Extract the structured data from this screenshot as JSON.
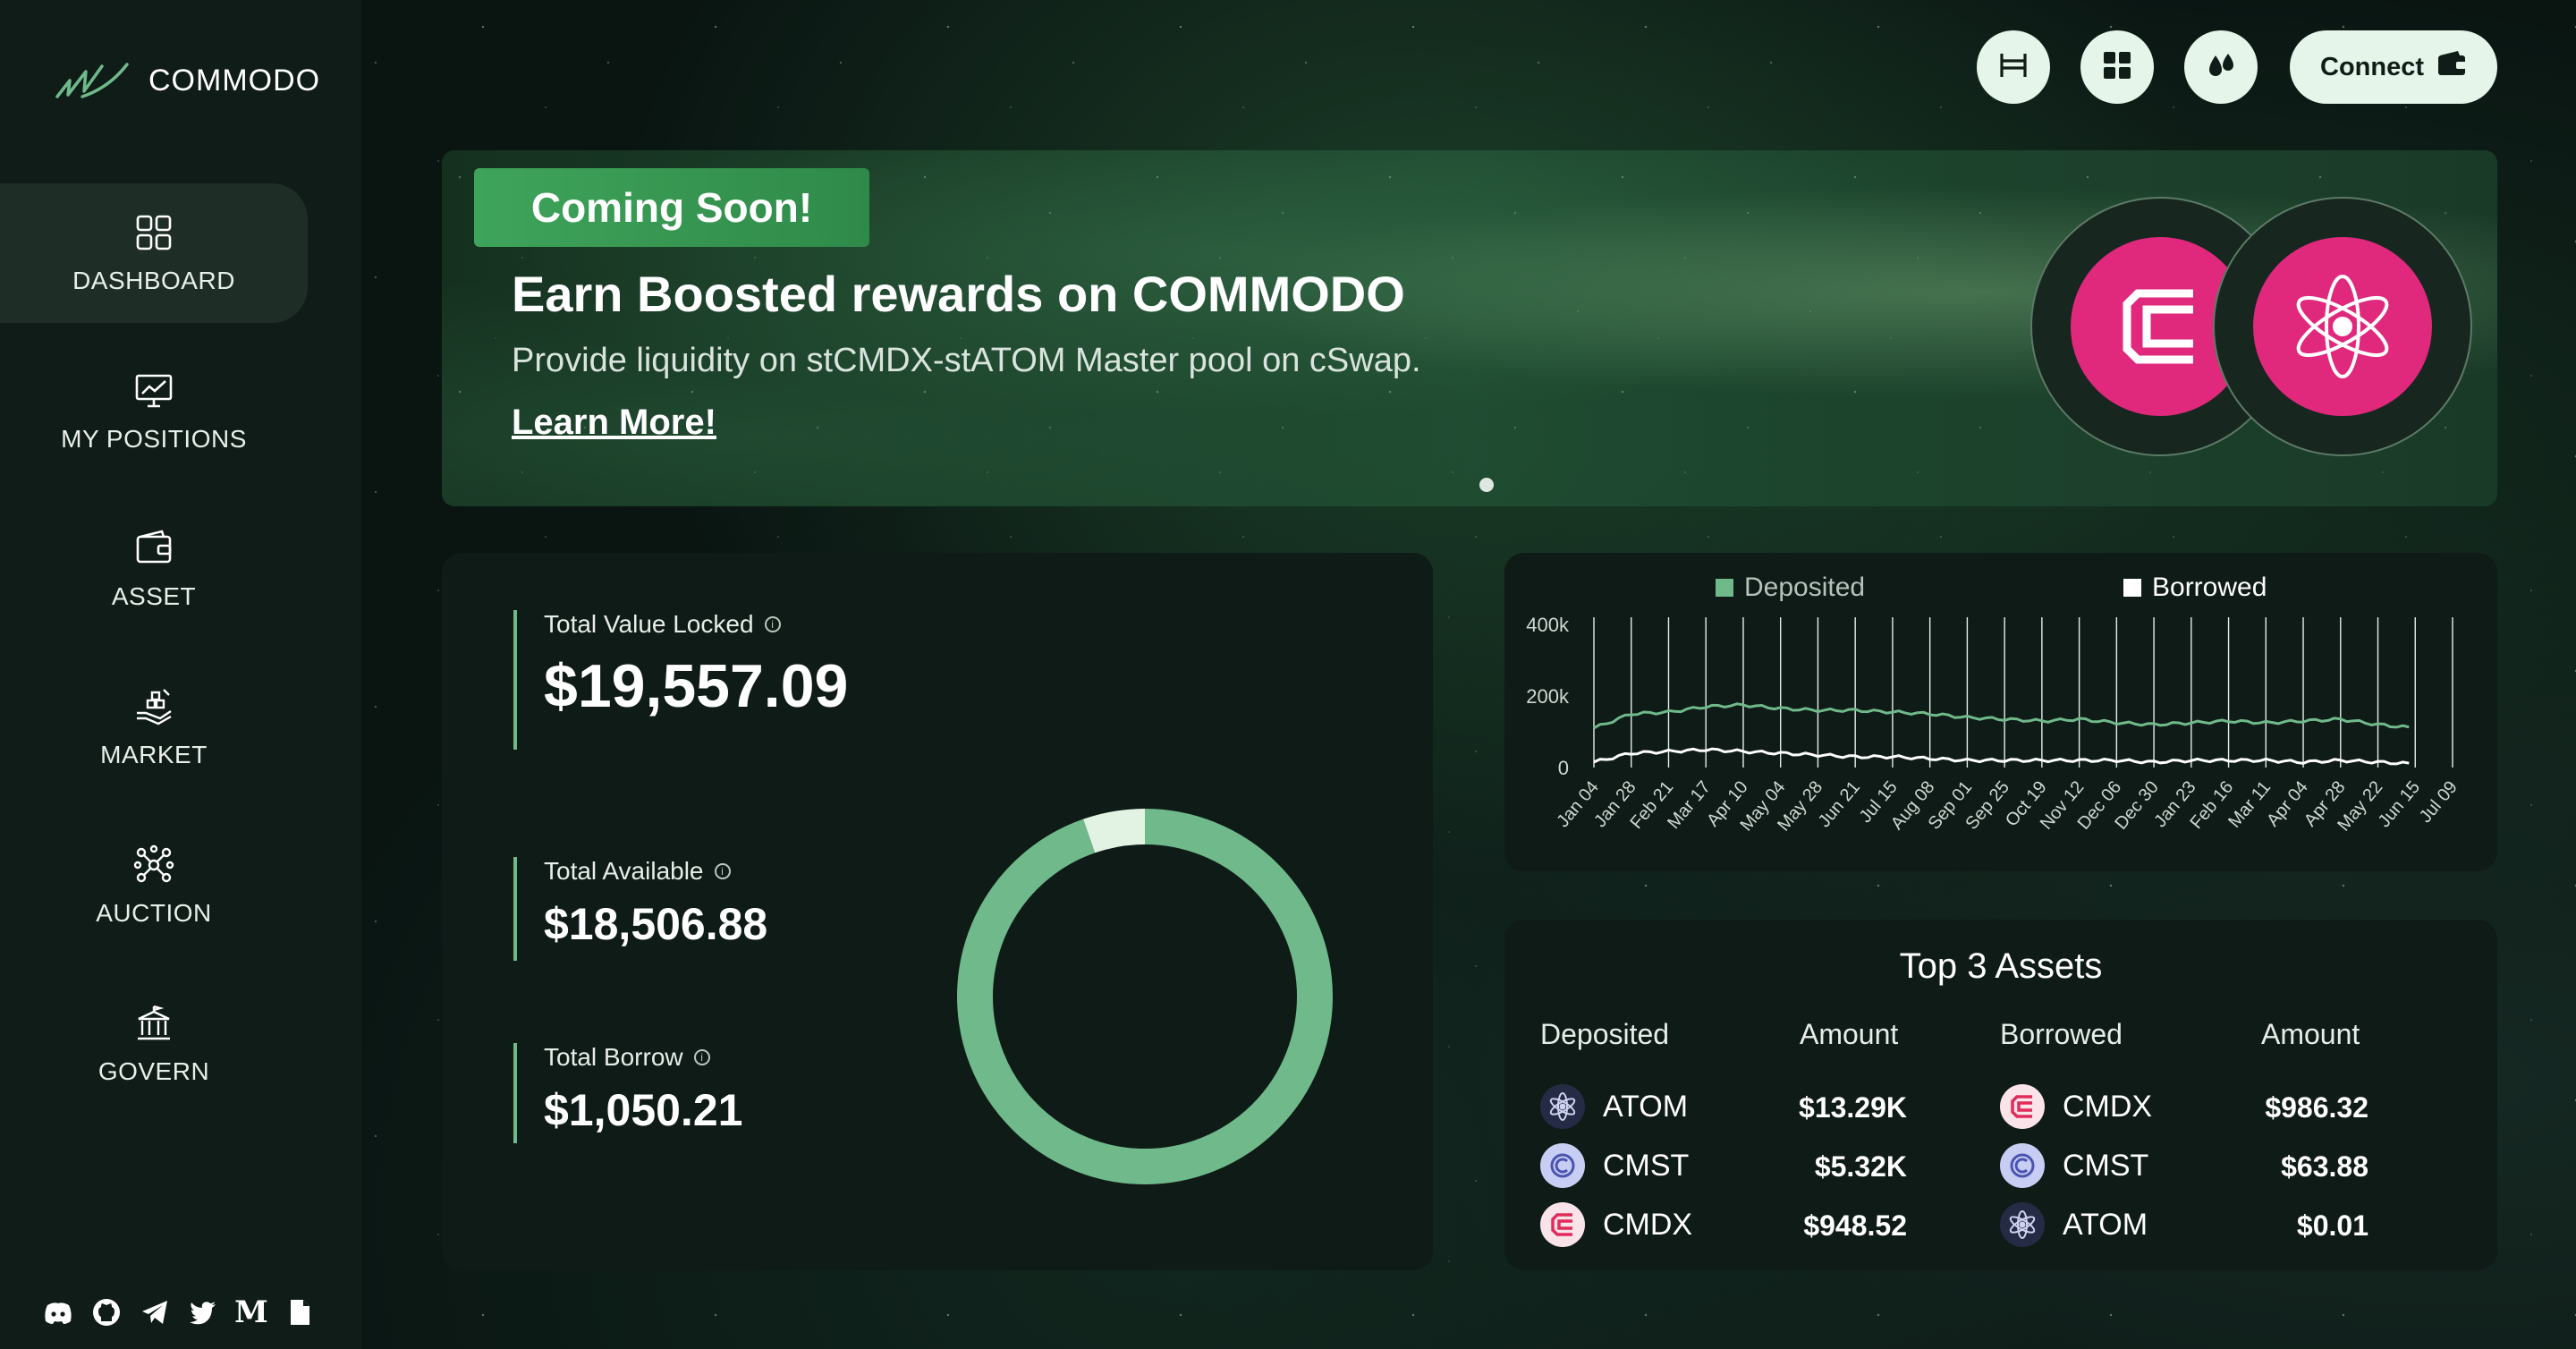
{
  "brand": {
    "name": "COMMODO"
  },
  "sidebar": {
    "items": [
      {
        "label": "DASHBOARD"
      },
      {
        "label": "MY POSITIONS"
      },
      {
        "label": "ASSET"
      },
      {
        "label": "MARKET"
      },
      {
        "label": "AUCTION"
      },
      {
        "label": "GOVERN"
      }
    ]
  },
  "header": {
    "connect_label": "Connect"
  },
  "banner": {
    "badge": "Coming Soon!",
    "title": "Earn Boosted rewards on COMMODO",
    "subtitle": "Provide liquidity on stCMDX-stATOM Master pool on cSwap.",
    "link": "Learn More!"
  },
  "stats": {
    "tvl_label": "Total Value Locked",
    "tvl_value": "$19,557.09",
    "available_label": "Total Available",
    "available_value": "$18,506.88",
    "borrow_label": "Total Borrow",
    "borrow_value": "$1,050.21",
    "donut": {
      "available": 18506.88,
      "borrow": 1050.21,
      "available_color": "#6fb98a",
      "borrow_color": "#e2f3e4"
    }
  },
  "chart_data": {
    "type": "line",
    "series": [
      {
        "name": "Deposited",
        "color": "#6fb98a"
      },
      {
        "name": "Borrowed",
        "color": "#ffffff"
      }
    ],
    "y_ticks": [
      "400k",
      "200k",
      "0"
    ],
    "x_ticks": [
      "Jan 04",
      "Jan 28",
      "Feb 21",
      "Mar 17",
      "Apr 10",
      "May 04",
      "May 28",
      "Jun 21",
      "Jul 15",
      "Aug 08",
      "Sep 01",
      "Sep 25",
      "Oct 19",
      "Nov 12",
      "Dec 06",
      "Dec 30",
      "Jan 23",
      "Feb 16",
      "Mar 11",
      "Apr 04",
      "Apr 28",
      "May 22",
      "Jun 15",
      "Jul 09"
    ],
    "ylim": [
      0,
      400000
    ],
    "deposited_approx": [
      110000,
      150000,
      155000,
      170000,
      175000,
      165000,
      160000,
      160000,
      155000,
      150000,
      140000,
      135000,
      130000,
      135000,
      125000,
      120000,
      125000,
      130000,
      125000,
      130000,
      135000,
      120000,
      110000,
      95000
    ],
    "borrowed_approx": [
      15000,
      40000,
      45000,
      50000,
      45000,
      40000,
      35000,
      30000,
      30000,
      25000,
      20000,
      20000,
      20000,
      20000,
      20000,
      15000,
      20000,
      20000,
      20000,
      15000,
      20000,
      15000,
      10000,
      10000
    ]
  },
  "top_assets": {
    "title": "Top 3 Assets",
    "headers": {
      "deposited": "Deposited",
      "amount1": "Amount",
      "borrowed": "Borrowed",
      "amount2": "Amount"
    },
    "deposited": [
      {
        "name": "ATOM",
        "amount": "$13.29K",
        "icon": "atom-icon"
      },
      {
        "name": "CMST",
        "amount": "$5.32K",
        "icon": "cmst-icon"
      },
      {
        "name": "CMDX",
        "amount": "$948.52",
        "icon": "cmdx-icon"
      }
    ],
    "borrowed": [
      {
        "name": "CMDX",
        "amount": "$986.32",
        "icon": "cmdx-icon"
      },
      {
        "name": "CMST",
        "amount": "$63.88",
        "icon": "cmst-icon"
      },
      {
        "name": "ATOM",
        "amount": "$0.01",
        "icon": "atom-icon"
      }
    ]
  }
}
